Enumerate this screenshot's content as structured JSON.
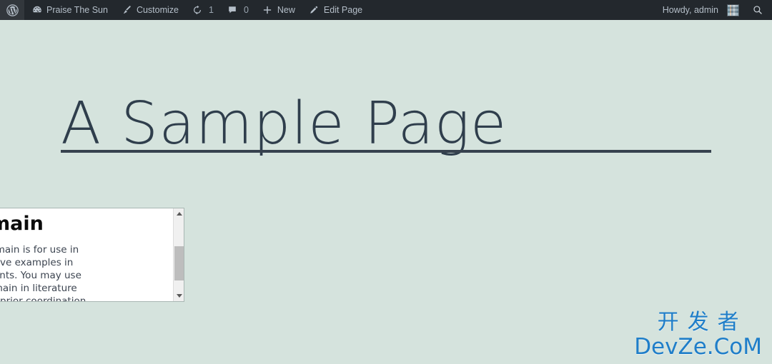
{
  "adminbar": {
    "background": "#23282d",
    "text_color": "#b5bfc9",
    "left_items": [
      {
        "name": "wp-logo",
        "icon": "wordpress-logo-icon",
        "label": ""
      },
      {
        "name": "site-name",
        "icon": "dashboard-icon",
        "label": "Praise The Sun"
      },
      {
        "name": "customize",
        "icon": "paintbrush-icon",
        "label": "Customize"
      },
      {
        "name": "updates",
        "icon": "update-arrows-icon",
        "label": "1"
      },
      {
        "name": "comments",
        "icon": "comment-bubble-icon",
        "label": "0"
      },
      {
        "name": "new-content",
        "icon": "plus-icon",
        "label": "New"
      },
      {
        "name": "edit-page",
        "icon": "pencil-icon",
        "label": "Edit Page"
      }
    ],
    "right_items": {
      "howdy": "Howdy, admin",
      "avatar_icon": "avatar",
      "search_icon": "search-icon"
    }
  },
  "page": {
    "background": "#d5e3dd",
    "title": "A Sample Page",
    "title_color": "#2f3e4c",
    "divider_color": "#37424e"
  },
  "embed": {
    "heading": "Domain",
    "body": "This domain is for use in illustrative examples in documents. You may use this domain in literature without prior coordination or asking",
    "scrollbar": {
      "up_arrow_icon": "scroll-up-arrow-icon",
      "down_arrow_icon": "scroll-down-arrow-icon",
      "thumb_name": "scrollbar-thumb"
    }
  },
  "watermark": {
    "cn": "开发者",
    "en": "DevZe.CoM",
    "color": "#1f7ec9"
  }
}
